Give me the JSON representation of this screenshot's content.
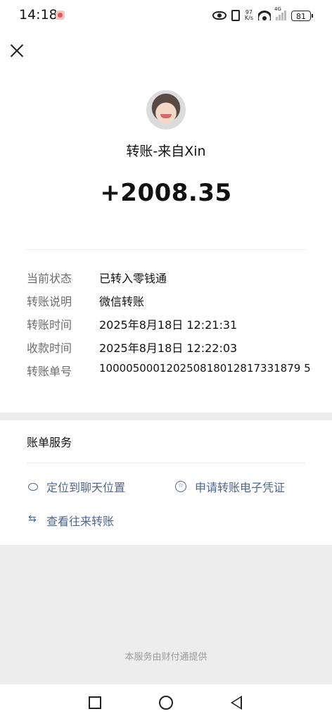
{
  "status_bar": {
    "time": "14:18",
    "net_speed_value": "97",
    "net_speed_unit": "K/s",
    "network_type": "4G",
    "battery": "81"
  },
  "transfer": {
    "from_title": "转账-来自Xin",
    "amount": "+2008.35"
  },
  "details": [
    {
      "label": "当前状态",
      "value": "已转入零钱通"
    },
    {
      "label": "转账说明",
      "value": "微信转账"
    },
    {
      "label": "转账时间",
      "value": "2025年8月18日 12:21:31"
    },
    {
      "label": "收款时间",
      "value": "2025年8月18日 12:22:03"
    },
    {
      "label": "转账单号",
      "value": "100005000120250818012817331879 5"
    }
  ],
  "services": {
    "title": "账单服务",
    "locate_chat": "定位到聊天位置",
    "apply_voucher": "申请转账电子凭证",
    "view_transfers": "查看往来转账"
  },
  "footer": "本服务由财付通提供",
  "colors": {
    "link": "#50648c",
    "background": "#ededed"
  },
  "icons": [
    "close-icon",
    "eye-icon",
    "vibrate-icon",
    "wifi-icon",
    "signal-icon",
    "chat-bubble-icon",
    "certificate-icon",
    "swap-arrows-icon"
  ]
}
